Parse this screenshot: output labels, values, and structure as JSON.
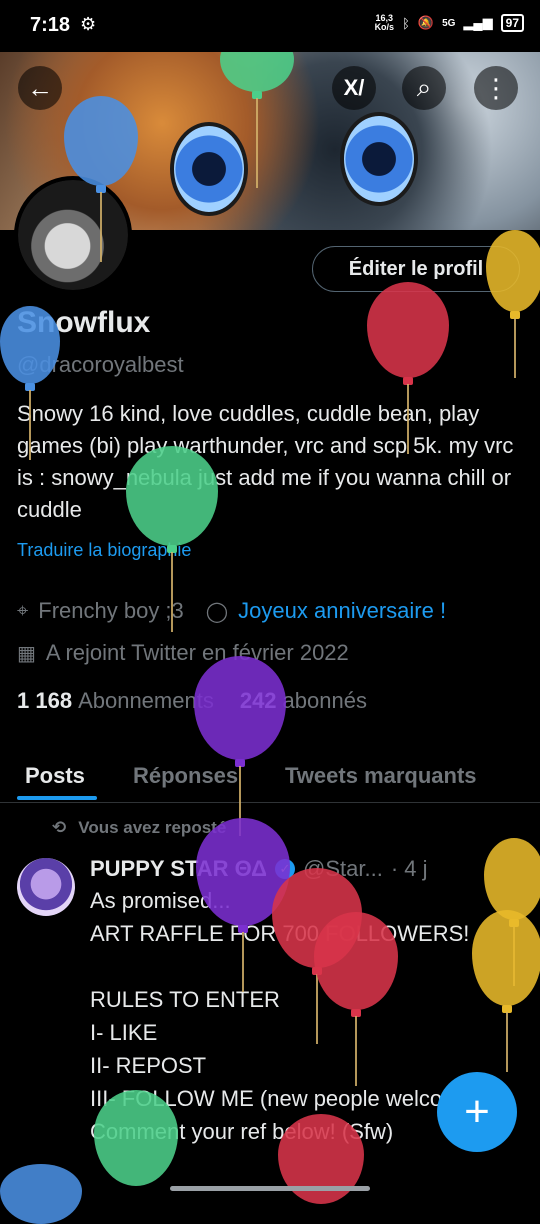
{
  "status_bar": {
    "time": "7:18",
    "net_speed_value": "16,3",
    "net_speed_unit": "Ko/s",
    "network": "5G",
    "battery": "97"
  },
  "header": {
    "back_icon": "arrow-left-icon",
    "grok_icon": "grok-icon",
    "search_icon": "search-icon",
    "more_icon": "more-vertical-icon"
  },
  "profile": {
    "edit_label": "Éditer le profil",
    "name": "Snowflux",
    "handle": "@dracoroyalbest",
    "bio": "Snowy 16 kind, love cuddles, cuddle bean, play games (bi) play warthunder, vrc and scp 5k. my vrc is : snowy_nebula just add me if you wanna chill or cuddle",
    "translate_label": "Traduire la biographie",
    "location": "Frenchy boy ;3",
    "birthday": "Joyeux anniversaire !",
    "joined": "A rejoint Twitter en février 2022",
    "following_count": "1 168",
    "following_label": "Abonnements",
    "followers_count": "242",
    "followers_label": "abonnés"
  },
  "tabs": [
    {
      "label": "Posts",
      "active": true
    },
    {
      "label": "Réponses",
      "active": false
    },
    {
      "label": "Tweets marquants",
      "active": false
    }
  ],
  "post": {
    "repost_label": "Vous avez reposté",
    "author": "PUPPY STAR ΘΔ",
    "handle": "@Star...",
    "time": "· 4 j",
    "body": "As promised...\nART RAFFLE FOR 700 FOLLOWERS!\n\nRULES TO ENTER\nI- LIKE\nII- REPOST\nIII- FOLLOW ME (new people welcomed!)\nComment your ref below! (Sfw)"
  },
  "fab_label": "+",
  "balloon_colors": {
    "blue": "#4a90e2",
    "green": "#4ccf8a",
    "red": "#d8344a",
    "yellow": "#e8b92a",
    "purple": "#7b2fd0"
  }
}
